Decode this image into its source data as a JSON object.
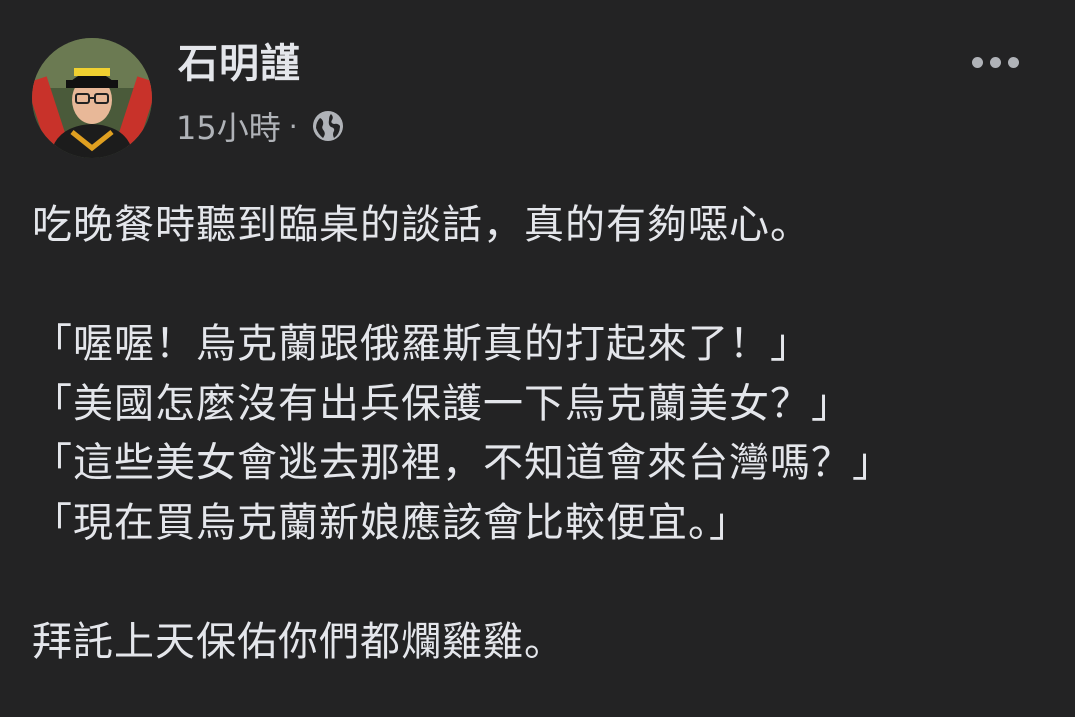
{
  "post": {
    "author": {
      "name": "石明謹",
      "avatar_icon": "profile-photo"
    },
    "timestamp": "15小時",
    "separator": "·",
    "audience_icon": "globe-icon",
    "more_icon": "more-options-icon",
    "lines": [
      "吃晚餐時聽到臨桌的談話，真的有夠噁心。",
      "",
      "「喔喔！烏克蘭跟俄羅斯真的打起來了！」",
      "「美國怎麼沒有出兵保護一下烏克蘭美女？」",
      "「這些美女會逃去那裡，不知道會來台灣嗎？」",
      "「現在買烏克蘭新娘應該會比較便宜。」",
      "",
      "拜託上天保佑你們都爛雞雞。"
    ]
  },
  "colors": {
    "background": "#232324",
    "primary_text": "#e4e6eb",
    "secondary_text": "#b0b3b8"
  }
}
